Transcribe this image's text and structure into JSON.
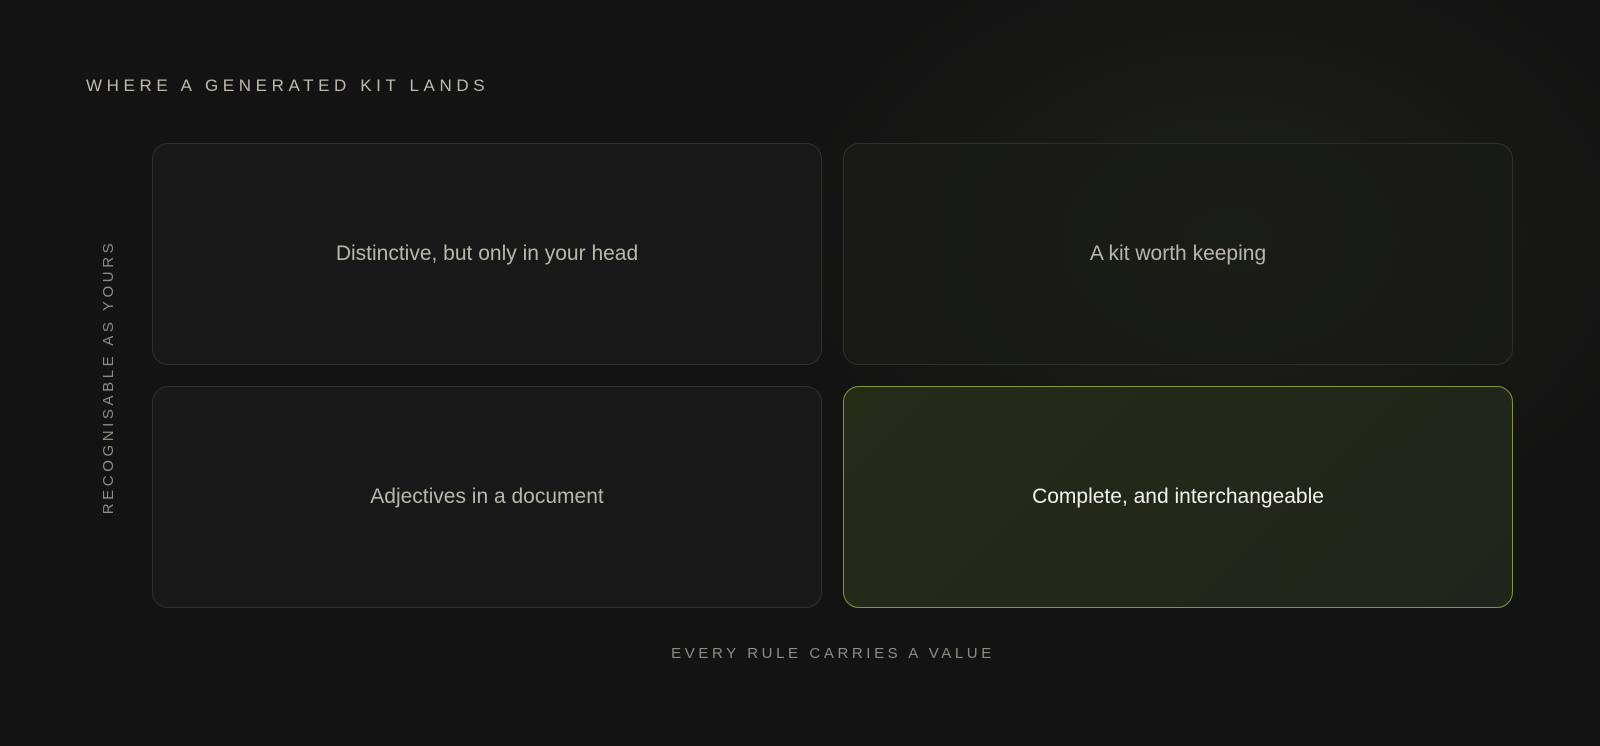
{
  "title": "WHERE A GENERATED KIT LANDS",
  "axes": {
    "y_label": "RECOGNISABLE AS YOURS",
    "x_label": "EVERY RULE CARRIES A VALUE"
  },
  "quadrants": {
    "top_left": "Distinctive, but only in your head",
    "top_right": "A kit worth keeping",
    "bottom_left": "Adjectives in a document",
    "bottom_right": "Complete, and interchangeable"
  },
  "colors": {
    "background": "#131313",
    "highlight_border": "#7e9a2c",
    "highlight_fill": "#262b18"
  }
}
